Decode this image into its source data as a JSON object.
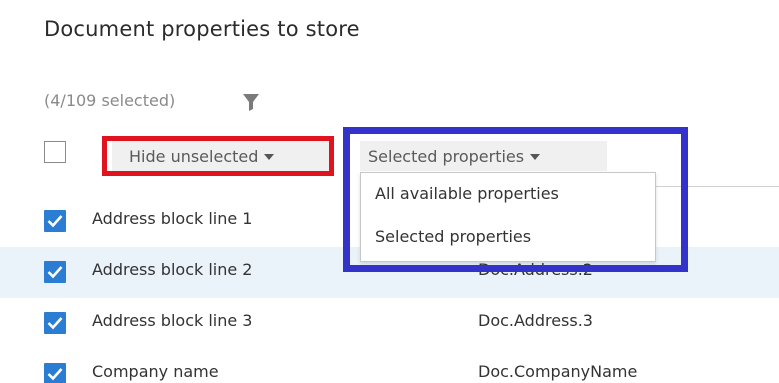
{
  "title": "Document properties to store",
  "selection_count": "(4/109 selected)",
  "filter_icon": "funnel-icon",
  "hide_unselected_label": "Hide unselected",
  "selected_properties_label": "Selected properties",
  "dropdown_options": [
    "All available properties",
    "Selected properties"
  ],
  "highlight_colors": {
    "red_box": "#e0141e",
    "blue_box": "#3333cc",
    "checkbox_checked": "#2b7cd3",
    "row_highlight": "#eaf2fa"
  },
  "rows": [
    {
      "name": "Address block line 1",
      "code": "",
      "checked": true
    },
    {
      "name": "Address block line 2",
      "code": "Doc.Address.2",
      "checked": true
    },
    {
      "name": "Address block line 3",
      "code": "Doc.Address.3",
      "checked": true
    },
    {
      "name": "Company name",
      "code": "Doc.CompanyName",
      "checked": true
    }
  ]
}
